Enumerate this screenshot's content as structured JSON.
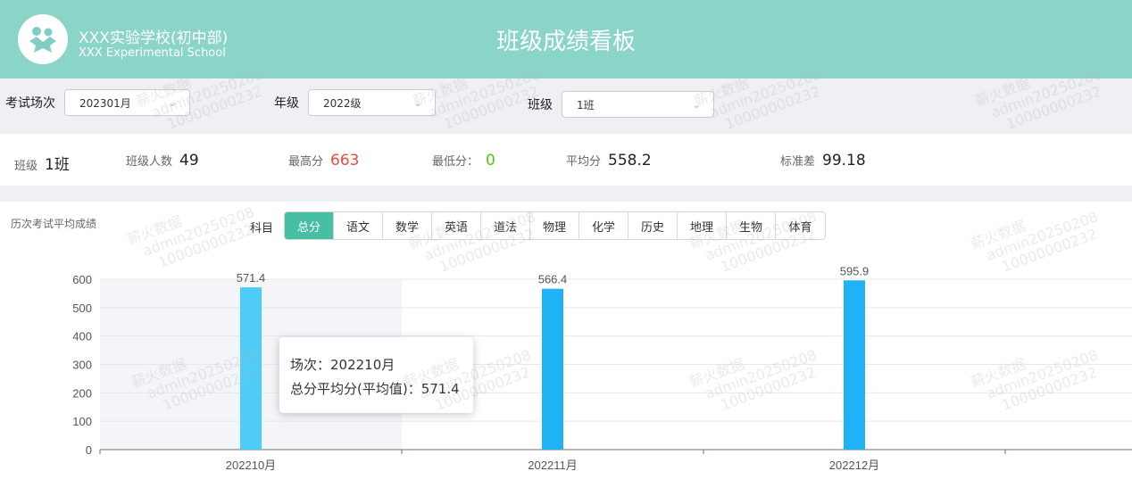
{
  "header": {
    "school_name_cn": "XXX实验学校(初中部)",
    "school_name_en": "XXX Experimental School",
    "title": "班级成绩看板"
  },
  "filters": {
    "exam_label": "考试场次",
    "exam_value": "202301月",
    "grade_label": "年级",
    "grade_value": "2022级",
    "class_label": "班级",
    "class_value": "1班"
  },
  "stats": {
    "class_label": "班级",
    "class_value": "1班",
    "count_label": "班级人数",
    "count_value": "49",
    "max_label": "最高分",
    "max_value": "663",
    "min_label": "最低分：",
    "min_value": "0",
    "avg_label": "平均分",
    "avg_value": "558.2",
    "std_label": "标准差",
    "std_value": "99.18"
  },
  "panel": {
    "title": "历次考试平均成绩",
    "subject_label": "科目",
    "subjects": [
      "总分",
      "语文",
      "数学",
      "英语",
      "道法",
      "物理",
      "化学",
      "历史",
      "地理",
      "生物",
      "体育"
    ],
    "active_subject": "总分"
  },
  "tooltip": {
    "line1": "场次：202210月",
    "line2": "总分平均分(平均值)：571.4"
  },
  "watermark": {
    "line1": "薪火数据",
    "line2": "admin20250208",
    "line3": "10000000232"
  },
  "colors": {
    "header": "#8bd4c8",
    "accent": "#46bfa5",
    "bar": "#1fb2f5",
    "bar_hover": "#4fcbf7",
    "max": "#e84c3d",
    "min": "#52c41a"
  },
  "chart_data": {
    "type": "bar",
    "categories": [
      "202210月",
      "202211月",
      "202212月"
    ],
    "values": [
      571.4,
      566.4,
      595.9
    ],
    "ylim": [
      0,
      600
    ],
    "yticks": [
      0,
      100,
      200,
      300,
      400,
      500,
      600
    ],
    "grid": true,
    "highlighted_category": "202210月"
  }
}
